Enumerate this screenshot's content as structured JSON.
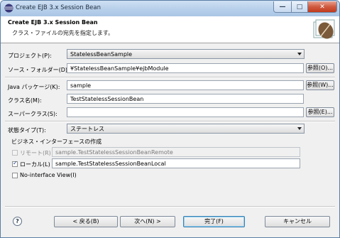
{
  "window": {
    "title": "Create EJB 3.x Session Bean",
    "controls": {
      "minimize": "—",
      "maximize": "□",
      "close": "✕"
    }
  },
  "header": {
    "title": "Create EJB 3.x Session Bean",
    "description": "クラス・ファイルの宛先を指定します。"
  },
  "form": {
    "project": {
      "label": "プロジェクト(P):",
      "value": "StatelessBeanSample"
    },
    "source_folder": {
      "label": "ソース・フォルダー(D):",
      "value": "¥StatelessBeanSample¥ejbModule",
      "button": "参照(O)..."
    },
    "java_package": {
      "label": "Java パッケージ(K):",
      "value": "sample",
      "button": "参照(W)..."
    },
    "class_name": {
      "label": "クラス名(M):",
      "value": "TestStatelessSessionBean"
    },
    "superclass": {
      "label": "スーパークラス(S):",
      "value": "",
      "button": "参照(E)..."
    },
    "state_type": {
      "label": "状態タイプ(T):",
      "value": "ステートレス"
    },
    "business_interfaces": {
      "label": "ビジネス・インターフェースの作成",
      "remote": {
        "label": "リモート(R)",
        "checked": false,
        "enabled": false,
        "value": "sample.TestStatelessSessionBeanRemote"
      },
      "local": {
        "label": "ローカル(L)",
        "checked": true,
        "enabled": true,
        "value": "sample.TestStatelessSessionBeanLocal"
      },
      "no_interface": {
        "label": "No-interface View(I)",
        "checked": false,
        "enabled": true
      }
    }
  },
  "footer": {
    "help_icon": "question-icon",
    "back": "< 戻る(B)",
    "next": "次へ(N) >",
    "finish": "完了(F)",
    "cancel": "キャンセル"
  }
}
